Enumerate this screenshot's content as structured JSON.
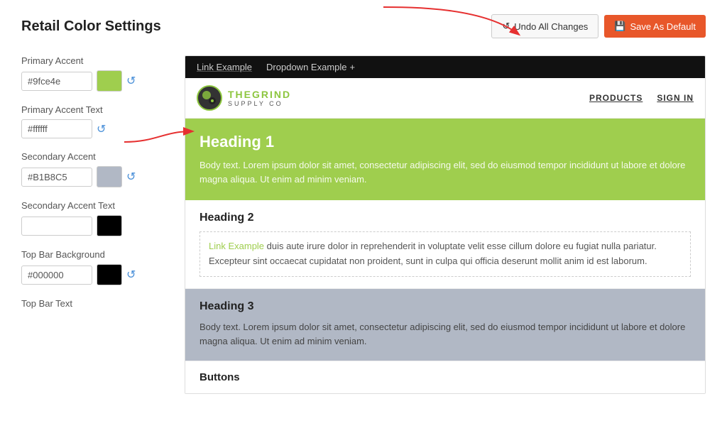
{
  "page": {
    "title": "Retail Color Settings"
  },
  "header": {
    "undo_label": "Undo All Changes",
    "save_label": "Save As Default"
  },
  "fields": [
    {
      "label": "Primary Accent",
      "value": "#9fce4e",
      "swatch_color": "#9fce4e",
      "show_swatch": true,
      "show_undo": true
    },
    {
      "label": "Primary Accent Text",
      "value": "#ffffff",
      "swatch_color": null,
      "show_swatch": false,
      "show_undo": true
    },
    {
      "label": "Secondary Accent",
      "value": "#B1B8C5",
      "swatch_color": "#B1B8C5",
      "show_swatch": true,
      "show_undo": true
    },
    {
      "label": "Secondary Accent Text",
      "value": "",
      "swatch_color": "#000000",
      "show_swatch": true,
      "show_undo": false
    },
    {
      "label": "Top Bar Background",
      "value": "#000000",
      "swatch_color": "#000000",
      "show_swatch": true,
      "show_undo": true
    },
    {
      "label": "Top Bar Text",
      "value": "",
      "swatch_color": null,
      "show_swatch": false,
      "show_undo": false
    }
  ],
  "preview": {
    "topbar": {
      "link": "Link Example",
      "dropdown": "Dropdown Example",
      "dropdown_icon": "+"
    },
    "store_header": {
      "logo_main_before": "THE",
      "logo_main_accent": "GRIND",
      "logo_sub": "SUPPLY CO",
      "nav_items": [
        "PRODUCTS",
        "SIGN IN"
      ]
    },
    "heading1": {
      "title": "Heading 1",
      "body": "Body text. Lorem ipsum dolor sit amet, consectetur adipiscing elit, sed do eiusmod tempor incididunt ut labore et dolore magna aliqua. Ut enim ad minim veniam."
    },
    "heading2": {
      "title": "Heading 2",
      "link_text": "Link Example",
      "body": " duis aute irure dolor in reprehenderit in voluptate velit esse cillum dolore eu fugiat nulla pariatur. Excepteur sint occaecat cupidatat non proident, sunt in culpa qui officia deserunt mollit anim id est laborum."
    },
    "heading3": {
      "title": "Heading 3",
      "body": "Body text. Lorem ipsum dolor sit amet, consectetur adipiscing elit, sed do eiusmod tempor incididunt ut labore et dolore magna aliqua. Ut enim ad minim veniam."
    },
    "buttons": {
      "title": "Buttons"
    }
  },
  "icons": {
    "undo": "↺",
    "save": "💾",
    "plus": "+",
    "undo_small": "↺"
  }
}
